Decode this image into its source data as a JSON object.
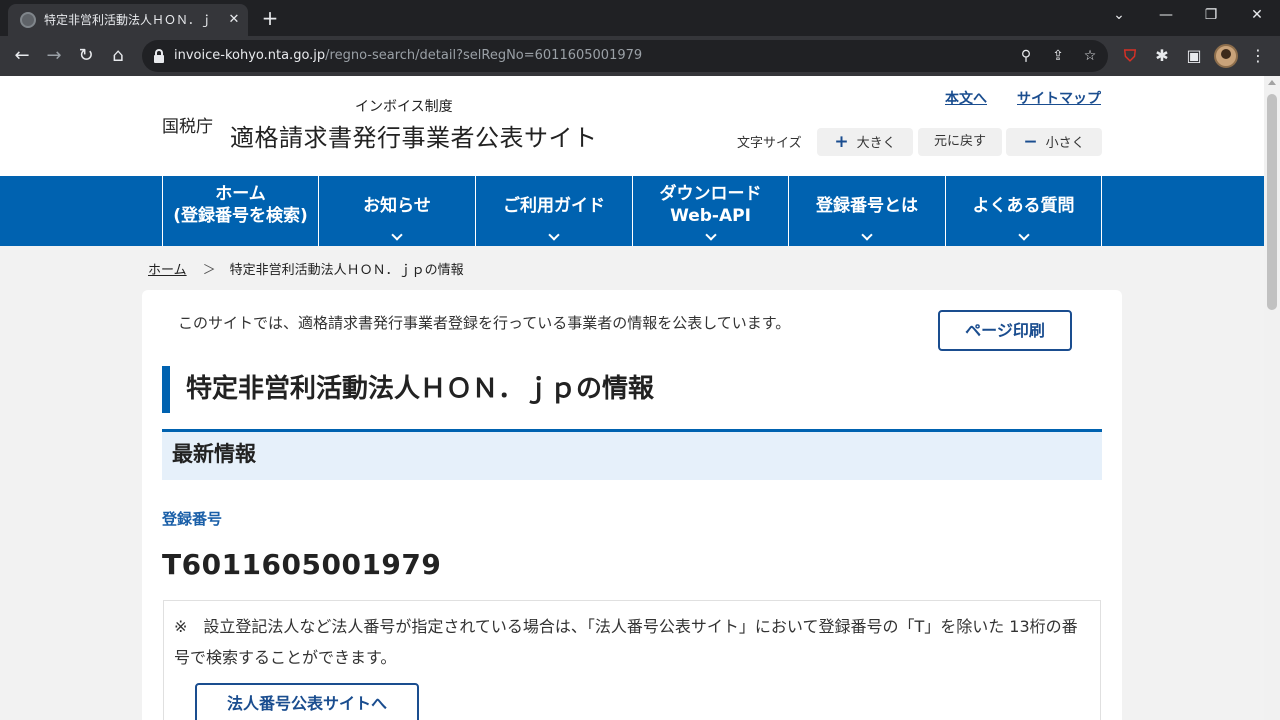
{
  "browser": {
    "tab_title": "特定非営利活動法人ＨＯＮ．ｊ",
    "tab_close": "✕",
    "new_tab": "+",
    "url_host": "invoice-kohyo.nta.go.jp",
    "url_path": "/regno-search/detail?selRegNo=6011605001979",
    "icons": {
      "back": "←",
      "forward": "→",
      "reload": "↻",
      "home": "⌂",
      "zoom": "⚲",
      "share": "⇪",
      "star": "☆",
      "shield": "⛉",
      "puzzle": "✱",
      "sidebar": "▣",
      "menu": "⋮",
      "tab_search": "⌄",
      "minimize": "—",
      "restore": "❐",
      "close": "✕"
    }
  },
  "header": {
    "agency": "国税庁",
    "subtitle": "インボイス制度",
    "title": "適格請求書発行事業者公表サイト",
    "link_main": "本文へ",
    "link_sitemap": "サイトマップ",
    "font_size_label": "文字サイズ",
    "font_larger_sym": "+",
    "font_larger": "大きく",
    "font_reset": "元に戻す",
    "font_smaller_sym": "−",
    "font_smaller": "小さく"
  },
  "nav": [
    {
      "line1": "ホーム",
      "line2": "(登録番号を検索)"
    },
    {
      "line1": "お知らせ",
      "line2": ""
    },
    {
      "line1": "ご利用ガイド",
      "line2": ""
    },
    {
      "line1": "ダウンロード",
      "line2": "Web-API"
    },
    {
      "line1": "登録番号とは",
      "line2": ""
    },
    {
      "line1": "よくある質問",
      "line2": ""
    }
  ],
  "breadcrumb": {
    "home": "ホーム",
    "sep": "＞",
    "current": "特定非営利活動法人ＨＯＮ．ｊｐの情報"
  },
  "main": {
    "intro": "このサイトでは、適格請求書発行事業者登録を行っている事業者の情報を公表しています。",
    "print_button": "ページ印刷",
    "page_title": "特定非営利活動法人ＨＯＮ．ｊｐの情報",
    "section_title": "最新情報",
    "reg_label": "登録番号",
    "reg_number": "T6011605001979",
    "note": "※　設立登記法人など法人番号が指定されている場合は、「法人番号公表サイト」において登録番号の「T」を除いた 13桁の番号で検索することができます。",
    "corp_button": "法人番号公表サイトへ"
  },
  "colors": {
    "nav_blue": "#0062b0",
    "link_blue": "#1a4d8f",
    "section_bg": "#e6f0fa"
  }
}
